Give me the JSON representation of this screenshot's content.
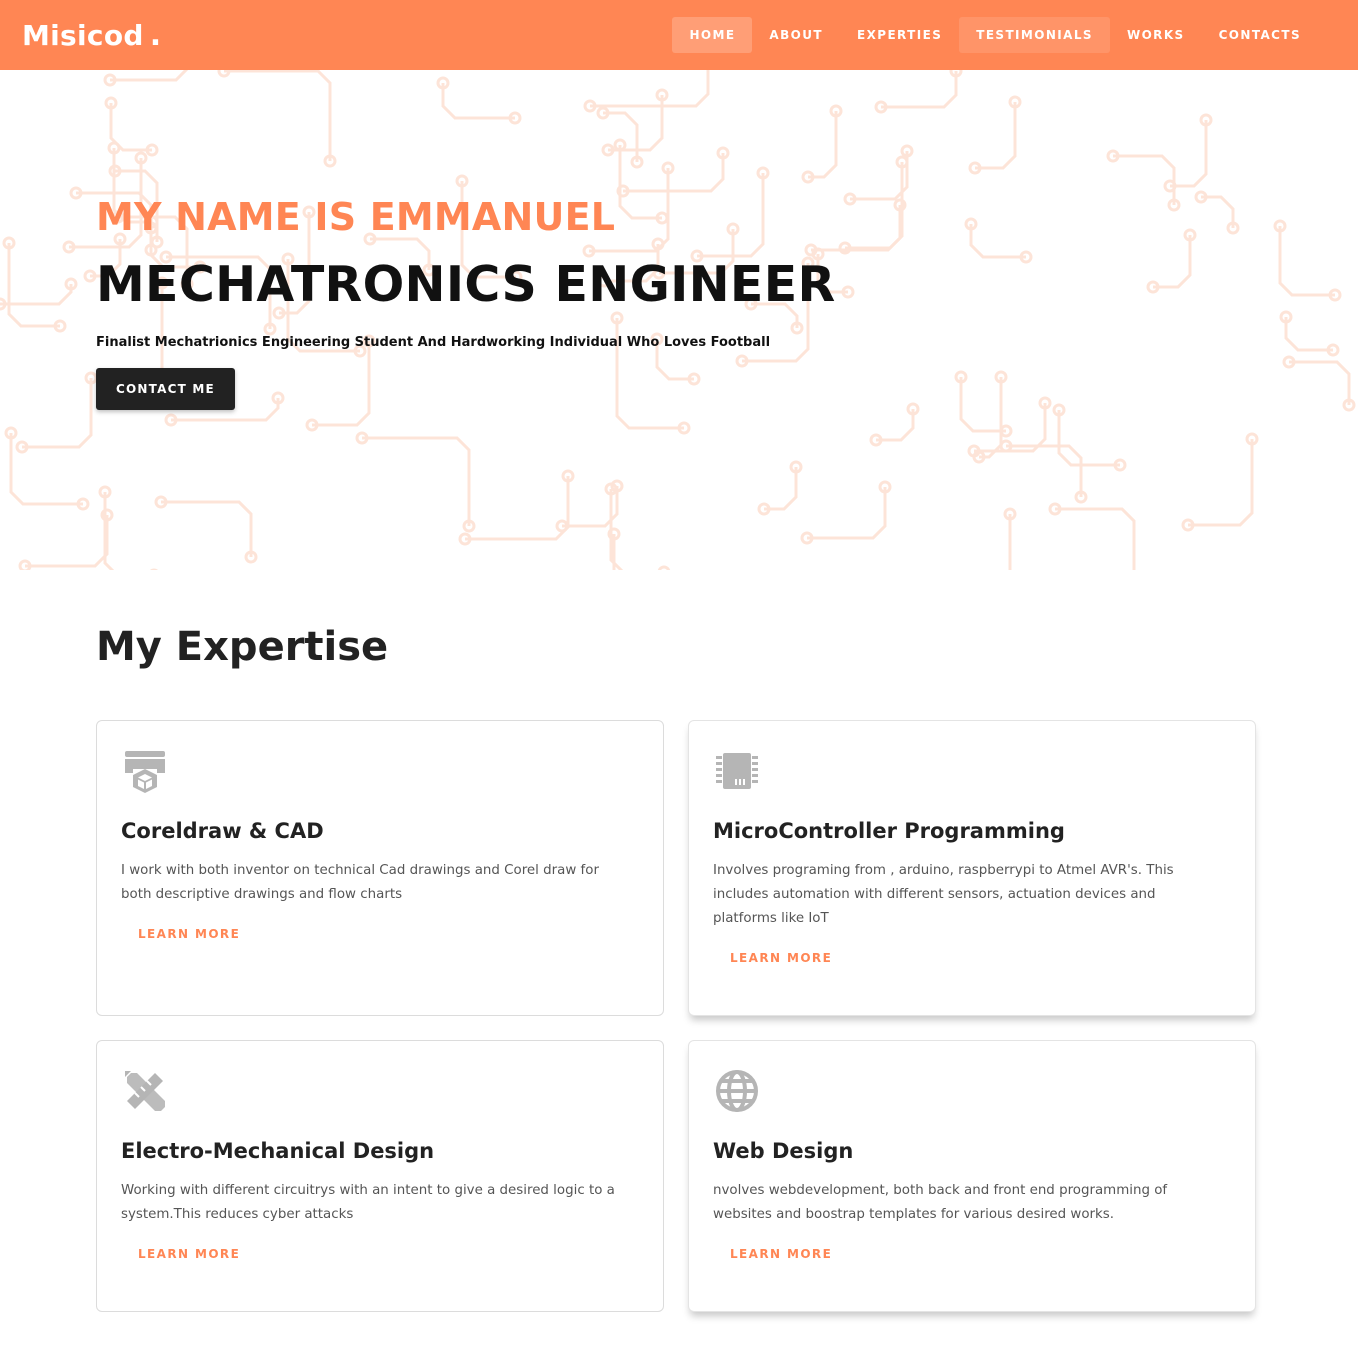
{
  "brand": {
    "name": "Misicod",
    "dot": "."
  },
  "nav": {
    "items": [
      {
        "label": "HOME"
      },
      {
        "label": "ABOUT"
      },
      {
        "label": "EXPERTIES"
      },
      {
        "label": "TESTIMONIALS"
      },
      {
        "label": "WORKS"
      },
      {
        "label": "CONTACTS"
      }
    ],
    "active": "HOME"
  },
  "hero": {
    "intro": "MY NAME IS EMMANUEL",
    "title": "MECHATRONICS ENGINEER",
    "subtitle": "Finalist Mechatrionics Engineering Student And Hardworking Individual Who Loves Football",
    "cta_label": "CONTACT ME"
  },
  "expertise": {
    "title": "My Expertise",
    "cards": [
      {
        "icon": "printer-3d-icon",
        "title": "Coreldraw & CAD",
        "text": "I work with both inventor on technical Cad drawings and Corel draw for both descriptive drawings and flow charts",
        "link": "LEARN MORE"
      },
      {
        "icon": "chip-icon",
        "title": "MicroController Programming",
        "text": "Involves programing from , arduino, raspberrypi to Atmel AVR's. This includes automation with different sensors, actuation devices and platforms like IoT",
        "link": "LEARN MORE"
      },
      {
        "icon": "pencil-ruler-icon",
        "title": "Electro-Mechanical Design",
        "text": "Working with different circuitrys with an intent to give a desired logic to a system.This reduces cyber attacks",
        "link": "LEARN MORE"
      },
      {
        "icon": "globe-icon",
        "title": "Web Design",
        "text": "nvolves webdevelopment, both back and front end programming of websites and boostrap templates for various desired works.",
        "link": "LEARN MORE"
      }
    ]
  },
  "colors": {
    "accent": "#ff8654",
    "dark": "#222222",
    "icon": "#b5b5b5",
    "pattern": "#fde4d8"
  }
}
